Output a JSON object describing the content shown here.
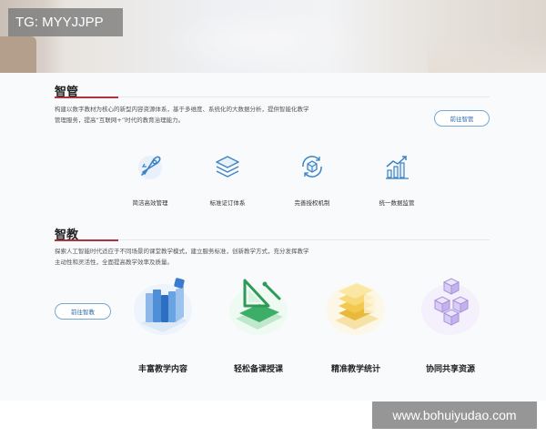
{
  "watermarks": {
    "top_left": "TG: MYYJJPP",
    "bottom_right": "www.bohuiyudao.com"
  },
  "zhiguan": {
    "title": "智管",
    "description_line1": "构建以数字教材为核心的新型内容资源体系，基于多维度、系统化的大数据分析，提供智能化教学",
    "description_line2": "管理服务，提高“互联网+”时代的教育治理能力。",
    "button_label": "前往智管",
    "features": [
      {
        "icon": "rocket-icon",
        "label": "简洁高效管理"
      },
      {
        "icon": "layers-icon",
        "label": "标准证订体系"
      },
      {
        "icon": "cube-cycle-icon",
        "label": "完善授权机制"
      },
      {
        "icon": "bar-chart-icon",
        "label": "统一数据监管"
      }
    ]
  },
  "zhijiao": {
    "title": "智教",
    "description_line1": "探索人工智能时代适应于不同场景的课堂教学模式，建立服务标准，创新教学方式，充分发挥教学",
    "description_line2": "主动性和灵活性，全面提高教学效率及质量。",
    "button_label": "前往智教",
    "features": [
      {
        "icon": "books-icon",
        "label": "丰富教学内容"
      },
      {
        "icon": "ruler-book-icon",
        "label": "轻松备课授课"
      },
      {
        "icon": "stacked-coins-icon",
        "label": "精准教学统计"
      },
      {
        "icon": "shared-cubes-icon",
        "label": "协同共享资源"
      }
    ]
  },
  "colors": {
    "accent_red": "#b0323b",
    "pill_blue": "#2d6aa8",
    "icon_blue": "#3b82c4"
  }
}
